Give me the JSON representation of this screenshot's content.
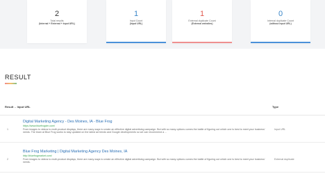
{
  "stats": [
    {
      "value": "2",
      "label": "Total results",
      "sub": "(Internal + External + Input URL)",
      "color": "#333333",
      "bar_color": ""
    },
    {
      "value": "1",
      "label": "Input Count",
      "sub": "(Input URL)",
      "color": "#3a86c8",
      "bar_color": "#4a90d9"
    },
    {
      "value": "1",
      "label": "External duplicate Count",
      "sub": "(External websites)",
      "color": "#e0564c",
      "bar_color": "#ef8f8f"
    },
    {
      "value": "0",
      "label": "Internal duplicate Count",
      "sub": "(without input URL)",
      "color": "#3a86c8",
      "bar_color": "#4a90d9"
    }
  ],
  "result": {
    "title": "RESULT"
  },
  "table": {
    "col_result": "Result",
    "col_input": "Input URL",
    "col_type": "Type"
  },
  "rows": [
    {
      "index": "1",
      "title": "Digital Marketing Agency - Des Moines, IA - Blue Frog",
      "url": "https://www.bluefrogdm.com/",
      "desc": "From images to videos to multi-product displays, there are many ways to create an effective digital advertising campaign. But with so many options comes the battle of figuring out which one is best to meet your business' needs. The team at Blue Frog works to stay updated on the latest ad trends and Google developments so we can recommend a ...",
      "type": "Input URL"
    },
    {
      "index": "2",
      "title": "Blue Frog Marketing | Digital Marketing Agency Des Moines, IA",
      "url": "http://bluefrogmarket.com/",
      "desc": "From images to videos to multi-product displays, there are many ways to create an effective digital advertising campaign. But with so many options comes the battle of figuring out which one is best to meet your business' needs.",
      "type": "External duplicate"
    }
  ]
}
